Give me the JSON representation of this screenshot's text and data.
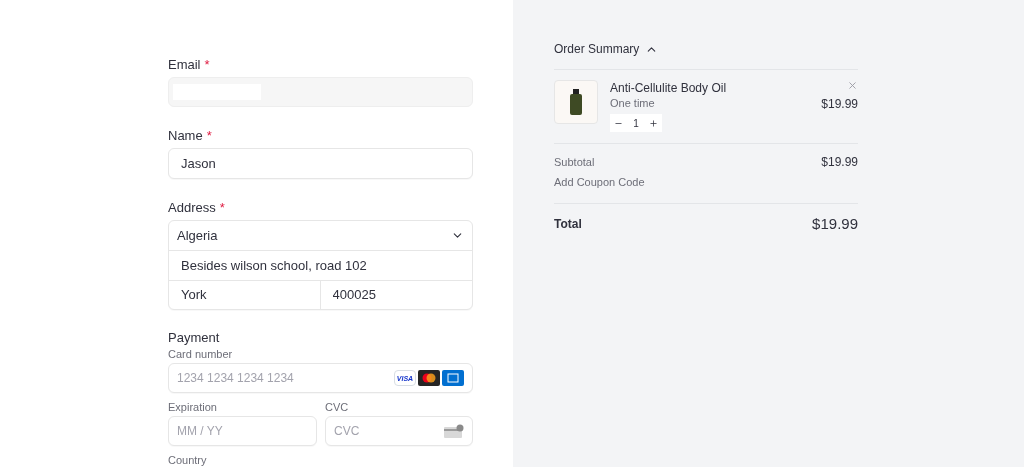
{
  "form": {
    "email": {
      "label": "Email",
      "required_mark": "*"
    },
    "name": {
      "label": "Name",
      "required_mark": "*",
      "value": "Jason"
    },
    "address": {
      "label": "Address",
      "required_mark": "*",
      "country": "Algeria",
      "line1": "Besides wilson school, road 102",
      "city": "York",
      "postal": "400025"
    },
    "payment": {
      "title": "Payment",
      "card_label": "Card number",
      "card_placeholder": "1234 1234 1234 1234",
      "card_brands": [
        {
          "kind": "visa",
          "label": "VISA"
        },
        {
          "kind": "mastercard"
        },
        {
          "kind": "amex"
        }
      ],
      "expiration_label": "Expiration",
      "expiration_placeholder": "MM / YY",
      "cvc_label": "CVC",
      "cvc_placeholder": "CVC",
      "country_label": "Country"
    }
  },
  "summary": {
    "title": "Order Summary",
    "expanded": true,
    "items": [
      {
        "name": "Anti-Cellulite Body Oil",
        "plan": "One time",
        "quantity": "1",
        "price": "$19.99"
      }
    ],
    "subtotal_label": "Subtotal",
    "subtotal": "$19.99",
    "coupon": "Add Coupon Code",
    "total_label": "Total",
    "total": "$19.99"
  }
}
